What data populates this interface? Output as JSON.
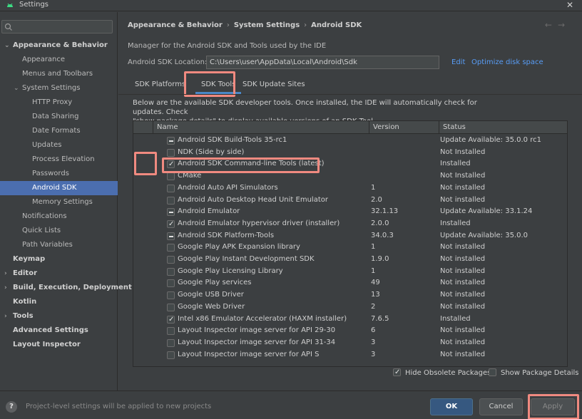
{
  "window": {
    "title": "Settings",
    "close": "✕"
  },
  "sidebar": {
    "search_placeholder": "",
    "items": [
      {
        "label": "Appearance & Behavior",
        "arrow": "⌄"
      },
      {
        "label": "Appearance"
      },
      {
        "label": "Menus and Toolbars"
      },
      {
        "label": "System Settings",
        "arrow": "⌄"
      },
      {
        "label": "HTTP Proxy"
      },
      {
        "label": "Data Sharing"
      },
      {
        "label": "Date Formats"
      },
      {
        "label": "Updates"
      },
      {
        "label": "Process Elevation"
      },
      {
        "label": "Passwords"
      },
      {
        "label": "Android SDK"
      },
      {
        "label": "Memory Settings"
      },
      {
        "label": "Notifications"
      },
      {
        "label": "Quick Lists"
      },
      {
        "label": "Path Variables"
      },
      {
        "label": "Keymap"
      },
      {
        "label": "Editor",
        "arrow": "›"
      },
      {
        "label": "Build, Execution, Deployment",
        "arrow": "›"
      },
      {
        "label": "Kotlin"
      },
      {
        "label": "Tools",
        "arrow": "›"
      },
      {
        "label": "Advanced Settings"
      },
      {
        "label": "Layout Inspector"
      }
    ]
  },
  "breadcrumb": {
    "part1": "Appearance & Behavior",
    "part2": "System Settings",
    "part3": "Android SDK",
    "sep": "›",
    "back": "←",
    "forward": "→"
  },
  "description": "Manager for the Android SDK and Tools used by the IDE",
  "sdk_location": {
    "label": "Android SDK Location:",
    "value": "C:\\Users\\user\\AppData\\Local\\Android\\Sdk",
    "edit": "Edit",
    "optimize": "Optimize disk space"
  },
  "tabs": {
    "platforms": "SDK Platforms",
    "tools": "SDK Tools",
    "update_sites": "SDK Update Sites"
  },
  "intro_line1": "Below are the available SDK developer tools. Once installed, the IDE will automatically check for updates. Check",
  "intro_line2": "\"show package details\" to display available versions of an SDK Tool.",
  "table": {
    "headers": {
      "name": "Name",
      "version": "Version",
      "status": "Status"
    },
    "rows": [
      {
        "name": "Android SDK Build-Tools 35-rc1",
        "version": "",
        "status": "Update Available: 35.0.0 rc1",
        "check": "partial"
      },
      {
        "name": "NDK (Side by side)",
        "version": "",
        "status": "Not Installed",
        "check": "none"
      },
      {
        "name": "Android SDK Command-line Tools (latest)",
        "version": "",
        "status": "Installed",
        "check": "checked"
      },
      {
        "name": "CMake",
        "version": "",
        "status": "Not Installed",
        "check": "none"
      },
      {
        "name": "Android Auto API Simulators",
        "version": "1",
        "status": "Not installed",
        "check": "none"
      },
      {
        "name": "Android Auto Desktop Head Unit Emulator",
        "version": "2.0",
        "status": "Not installed",
        "check": "none"
      },
      {
        "name": "Android Emulator",
        "version": "32.1.13",
        "status": "Update Available: 33.1.24",
        "check": "partial"
      },
      {
        "name": "Android Emulator hypervisor driver (installer)",
        "version": "2.0.0",
        "status": "Installed",
        "check": "checked"
      },
      {
        "name": "Android SDK Platform-Tools",
        "version": "34.0.3",
        "status": "Update Available: 35.0.0",
        "check": "partial"
      },
      {
        "name": "Google Play APK Expansion library",
        "version": "1",
        "status": "Not installed",
        "check": "none"
      },
      {
        "name": "Google Play Instant Development SDK",
        "version": "1.9.0",
        "status": "Not installed",
        "check": "none"
      },
      {
        "name": "Google Play Licensing Library",
        "version": "1",
        "status": "Not installed",
        "check": "none"
      },
      {
        "name": "Google Play services",
        "version": "49",
        "status": "Not installed",
        "check": "none"
      },
      {
        "name": "Google USB Driver",
        "version": "13",
        "status": "Not installed",
        "check": "none"
      },
      {
        "name": "Google Web Driver",
        "version": "2",
        "status": "Not installed",
        "check": "none"
      },
      {
        "name": "Intel x86 Emulator Accelerator (HAXM installer)",
        "version": "7.6.5",
        "status": "Installed",
        "check": "checked"
      },
      {
        "name": "Layout Inspector image server for API 29-30",
        "version": "6",
        "status": "Not installed",
        "check": "none"
      },
      {
        "name": "Layout Inspector image server for API 31-34",
        "version": "3",
        "status": "Not installed",
        "check": "none"
      },
      {
        "name": "Layout Inspector image server for API S",
        "version": "3",
        "status": "Not installed",
        "check": "none"
      }
    ]
  },
  "options": {
    "hide_obsolete": "Hide Obsolete Packages",
    "show_details": "Show Package Details"
  },
  "footer": {
    "help": "?",
    "message": "Project-level settings will be applied to new projects",
    "ok": "OK",
    "cancel": "Cancel",
    "apply": "Apply"
  }
}
